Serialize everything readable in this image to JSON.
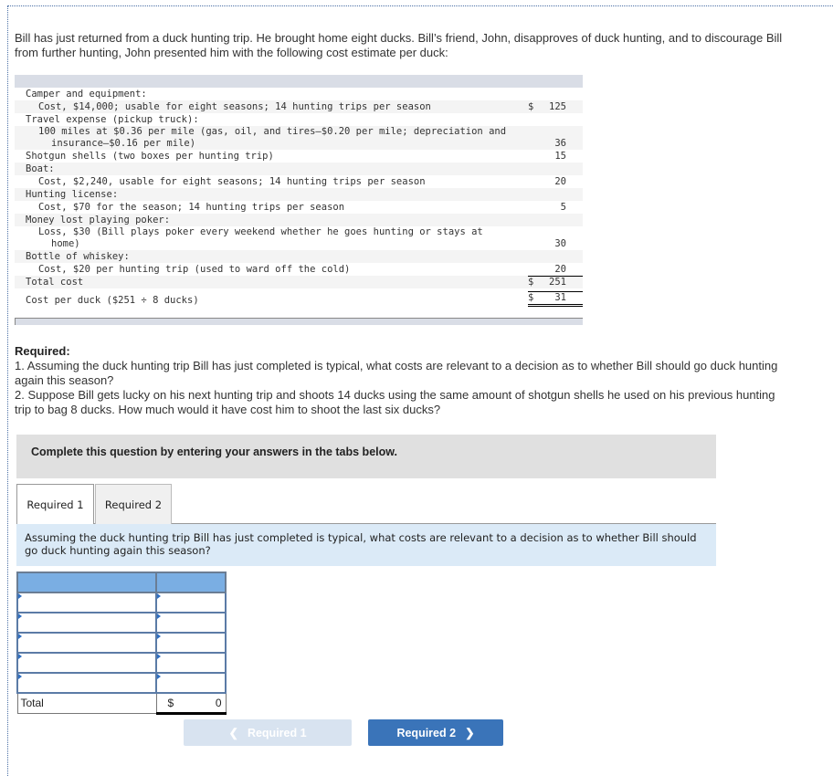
{
  "intro": "Bill has just returned from a duck hunting trip. He brought home eight ducks. Bill’s friend, John, disapproves of duck hunting, and to discourage Bill from further hunting, John presented him with the following cost estimate per duck:",
  "cost_table": {
    "rows": [
      {
        "desc": "Camper and equipment:",
        "indent": 0,
        "dollar": "",
        "amount": ""
      },
      {
        "desc": "Cost, $14,000; usable for eight seasons; 14 hunting trips per season",
        "indent": 1,
        "dollar": "$",
        "amount": "125"
      },
      {
        "desc": "Travel expense (pickup truck):",
        "indent": 0,
        "dollar": "",
        "amount": ""
      },
      {
        "desc": "100 miles at $0.36 per mile (gas, oil, and tires–$0.20 per mile; depreciation and",
        "wrap": "insurance–$0.16 per mile)",
        "indent": 1,
        "dollar": "",
        "amount": "36"
      },
      {
        "desc": "Shotgun shells (two boxes per hunting trip)",
        "indent": 0,
        "dollar": "",
        "amount": "15"
      },
      {
        "desc": "Boat:",
        "indent": 0,
        "dollar": "",
        "amount": ""
      },
      {
        "desc": "Cost, $2,240, usable for eight seasons; 14 hunting trips per season",
        "indent": 1,
        "dollar": "",
        "amount": "20"
      },
      {
        "desc": "Hunting license:",
        "indent": 0,
        "dollar": "",
        "amount": ""
      },
      {
        "desc": "Cost, $70 for the season; 14 hunting trips per season",
        "indent": 1,
        "dollar": "",
        "amount": "5"
      },
      {
        "desc": "Money lost playing poker:",
        "indent": 0,
        "dollar": "",
        "amount": ""
      },
      {
        "desc": "Loss, $30 (Bill plays poker every weekend whether he goes hunting or stays at",
        "wrap": "home)",
        "indent": 1,
        "dollar": "",
        "amount": "30"
      },
      {
        "desc": "Bottle of whiskey:",
        "indent": 0,
        "dollar": "",
        "amount": ""
      },
      {
        "desc": "Cost, $20 per hunting trip (used to ward off the cold)",
        "indent": 1,
        "dollar": "",
        "amount": "20"
      },
      {
        "desc": "Total cost",
        "indent": 0,
        "dollar": "$",
        "amount": "251"
      },
      {
        "desc": "Cost per duck ($251 ÷ 8 ducks)",
        "indent": 0,
        "dollar": "$",
        "amount": "31"
      }
    ]
  },
  "required": {
    "heading": "Required:",
    "q1": "1.  Assuming the duck hunting trip Bill has just completed is typical, what costs are relevant to a decision as to whether Bill should go duck hunting again this season?",
    "q2": "2. Suppose Bill gets lucky on his next hunting trip and shoots 14 ducks using the same amount of shotgun shells he used on his previous hunting trip to bag 8 ducks. How much would it have cost him to shoot the last six ducks?"
  },
  "instruction": "Complete this question by entering your answers in the tabs below.",
  "tabs": [
    {
      "label": "Required 1",
      "active": true
    },
    {
      "label": "Required 2",
      "active": false
    }
  ],
  "prompt": "Assuming the duck hunting trip Bill has just completed is typical, what costs are relevant to a decision as to whether Bill should go duck hunting again this season?",
  "answer_table": {
    "rows": [
      {
        "item": "",
        "amount": ""
      },
      {
        "item": "",
        "amount": ""
      },
      {
        "item": "",
        "amount": ""
      },
      {
        "item": "",
        "amount": ""
      },
      {
        "item": "",
        "amount": ""
      }
    ],
    "total_label": "Total",
    "total_dollar": "$",
    "total_value": "0"
  },
  "nav": {
    "prev_label": "Required 1",
    "next_label": "Required 2",
    "prev_icon": "chevron-left",
    "next_icon": "chevron-right"
  }
}
